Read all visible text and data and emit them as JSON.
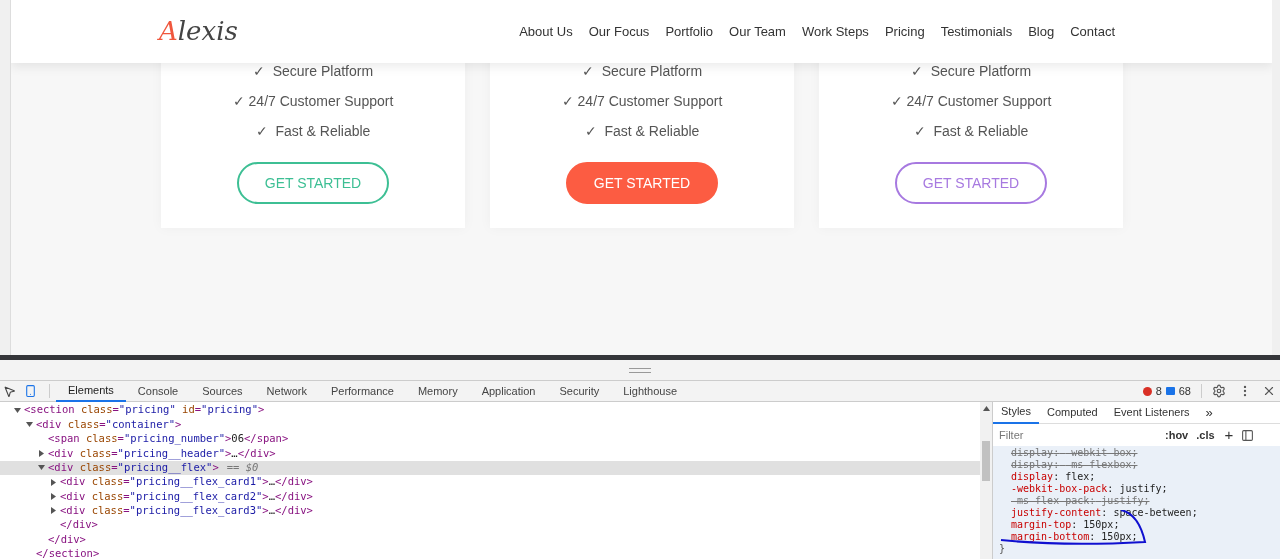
{
  "site": {
    "logo": "Alexis",
    "nav": [
      {
        "label": "About Us"
      },
      {
        "label": "Our Focus"
      },
      {
        "label": "Portfolio"
      },
      {
        "label": "Our Team"
      },
      {
        "label": "Work Steps"
      },
      {
        "label": "Pricing"
      },
      {
        "label": "Testimonials"
      },
      {
        "label": "Blog"
      },
      {
        "label": "Contact"
      }
    ],
    "cards": [
      {
        "features": [
          "✓  Secure Platform",
          "✓ 24/7 Customer Support",
          "✓  Fast & Reliable"
        ],
        "button": {
          "label": "GET STARTED",
          "kind": "outline",
          "color": "#3dbf94"
        }
      },
      {
        "features": [
          "✓  Secure Platform",
          "✓ 24/7 Customer Support",
          "✓  Fast & Reliable"
        ],
        "button": {
          "label": "GET STARTED",
          "kind": "filled",
          "color": "#fc5c42"
        }
      },
      {
        "features": [
          "✓  Secure Platform",
          "✓ 24/7 Customer Support",
          "✓  Fast & Reliable"
        ],
        "button": {
          "label": "GET STARTED",
          "kind": "outline",
          "color": "#a779e0"
        }
      }
    ]
  },
  "devtools": {
    "tabs": [
      {
        "label": "Elements",
        "selected": true
      },
      {
        "label": "Console",
        "selected": false
      },
      {
        "label": "Sources",
        "selected": false
      },
      {
        "label": "Network",
        "selected": false
      },
      {
        "label": "Performance",
        "selected": false
      },
      {
        "label": "Memory",
        "selected": false
      },
      {
        "label": "Application",
        "selected": false
      },
      {
        "label": "Security",
        "selected": false
      },
      {
        "label": "Lighthouse",
        "selected": false
      }
    ],
    "errors": "8",
    "messages": "68",
    "dom": [
      {
        "kind": "toggle",
        "text": "<section class=\"pricing\" id=\"pricing\">",
        "expanded": true,
        "selected": false,
        "children": [
          {
            "kind": "toggle",
            "text": "<div class=\"container\">",
            "expanded": true,
            "selected": false,
            "children": [
              {
                "kind": "plain",
                "text": "<span class=\"pricing_number\">06</span>",
                "selected": false
              },
              {
                "kind": "toggle",
                "text": "<div class=\"pricing__header\">…</div>",
                "expanded": false,
                "selected": false
              },
              {
                "kind": "toggle",
                "text": "<div class=\"pricing__flex\">",
                "suffix": "== $0",
                "expanded": true,
                "selected": true,
                "children": [
                  {
                    "kind": "toggle",
                    "text": "<div class=\"pricing__flex_card1\">…</div>",
                    "expanded": false,
                    "selected": false
                  },
                  {
                    "kind": "toggle",
                    "text": "<div class=\"pricing__flex_card2\">…</div>",
                    "expanded": false,
                    "selected": false
                  },
                  {
                    "kind": "toggle",
                    "text": "<div class=\"pricing__flex_card3\">…</div>",
                    "expanded": false,
                    "selected": false
                  },
                  {
                    "kind": "plain",
                    "text": "</div>",
                    "selected": false
                  }
                ]
              },
              {
                "kind": "plain",
                "text": "</div>",
                "selected": false
              }
            ]
          },
          {
            "kind": "plain",
            "text": "</section>",
            "selected": false
          }
        ]
      }
    ],
    "styles": {
      "tabs": [
        {
          "label": "Styles",
          "selected": true
        },
        {
          "label": "Computed",
          "selected": false
        },
        {
          "label": "Event Listeners",
          "selected": false
        }
      ],
      "more": "»",
      "filter_placeholder": "Filter",
      "hov": ":hov",
      "cls": ".cls",
      "add": "+",
      "declarations": [
        {
          "property": "display",
          "colon": ":",
          "value": "-webkit-box;",
          "struck": true
        },
        {
          "property": "display",
          "colon": ":",
          "value": "-ms-flexbox;",
          "struck": true
        },
        {
          "property": "display",
          "colon": ":",
          "value": "flex;",
          "struck": false
        },
        {
          "property": "-webkit-box-pack",
          "colon": ":",
          "value": "justify;",
          "struck": false
        },
        {
          "property": "-ms-flex-pack",
          "colon": ":",
          "value": "justify;",
          "struck": true
        },
        {
          "property": "justify-content",
          "colon": ":",
          "value": "space-between;",
          "struck": false
        },
        {
          "property": "margin-top",
          "colon": ":",
          "value": "150px;",
          "struck": false
        },
        {
          "property": "margin-bottom",
          "colon": ":",
          "value": "150px;",
          "struck": false
        }
      ],
      "closing": "}"
    }
  }
}
